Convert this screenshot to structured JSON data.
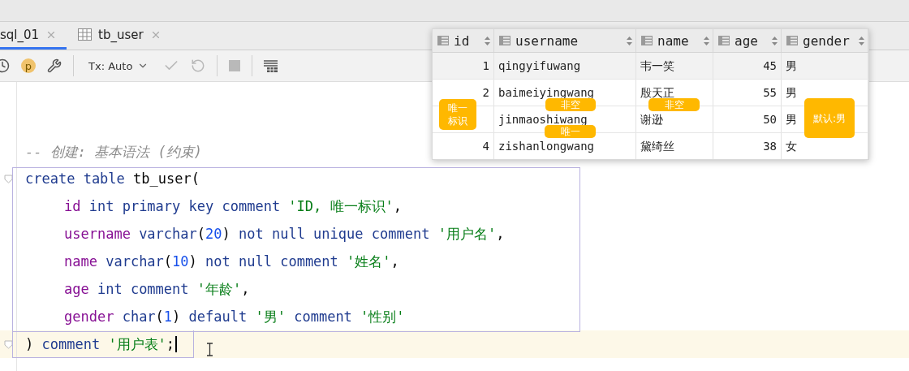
{
  "tabs": [
    {
      "label": "sql_01",
      "selected": true,
      "kind": "console"
    },
    {
      "label": "tb_user",
      "selected": false,
      "kind": "table"
    }
  ],
  "toolbar": {
    "profile": "p",
    "transaction": "Tx: Auto",
    "actions": [
      {
        "kind": "commit",
        "disabled": true
      },
      {
        "kind": "rollback",
        "disabled": true
      },
      {
        "kind": "stop",
        "disabled": true
      }
    ]
  },
  "editor": {
    "lines": [
      {
        "kind": "comment",
        "fold": false,
        "indent": false,
        "current": false,
        "tokens": [
          {
            "kind": "comment",
            "text": "-- 创建: 基本语法 (约束)"
          }
        ]
      },
      {
        "kind": "code",
        "fold": true,
        "indent": false,
        "current": false,
        "tokens": [
          {
            "kind": "keyword",
            "text": "create table "
          },
          {
            "kind": "plain",
            "text": "tb_user("
          }
        ]
      },
      {
        "kind": "code",
        "fold": false,
        "indent": true,
        "current": false,
        "tokens": [
          {
            "kind": "field",
            "text": "id"
          },
          {
            "kind": "keyword",
            "text": " int primary key comment "
          },
          {
            "kind": "string",
            "text": "'ID, 唯一标识'"
          },
          {
            "kind": "plain",
            "text": ","
          }
        ]
      },
      {
        "kind": "code",
        "fold": false,
        "indent": true,
        "current": false,
        "tokens": [
          {
            "kind": "field",
            "text": "username"
          },
          {
            "kind": "keyword",
            "text": " varchar"
          },
          {
            "kind": "plain",
            "text": "("
          },
          {
            "kind": "number",
            "text": "20"
          },
          {
            "kind": "plain",
            "text": ") "
          },
          {
            "kind": "keyword",
            "text": "not null unique comment "
          },
          {
            "kind": "string",
            "text": "'用户名'"
          },
          {
            "kind": "plain",
            "text": ","
          }
        ]
      },
      {
        "kind": "code",
        "fold": false,
        "indent": true,
        "current": false,
        "tokens": [
          {
            "kind": "field",
            "text": "name"
          },
          {
            "kind": "keyword",
            "text": " varchar"
          },
          {
            "kind": "plain",
            "text": "("
          },
          {
            "kind": "number",
            "text": "10"
          },
          {
            "kind": "plain",
            "text": ") "
          },
          {
            "kind": "keyword",
            "text": "not null comment "
          },
          {
            "kind": "string",
            "text": "'姓名'"
          },
          {
            "kind": "plain",
            "text": ","
          }
        ]
      },
      {
        "kind": "code",
        "fold": false,
        "indent": true,
        "current": false,
        "tokens": [
          {
            "kind": "field",
            "text": "age"
          },
          {
            "kind": "keyword",
            "text": " int comment "
          },
          {
            "kind": "string",
            "text": "'年龄'"
          },
          {
            "kind": "plain",
            "text": ","
          }
        ]
      },
      {
        "kind": "code",
        "fold": false,
        "indent": true,
        "current": false,
        "tokens": [
          {
            "kind": "field",
            "text": "gender"
          },
          {
            "kind": "keyword",
            "text": " char"
          },
          {
            "kind": "plain",
            "text": "("
          },
          {
            "kind": "number",
            "text": "1"
          },
          {
            "kind": "plain",
            "text": ") "
          },
          {
            "kind": "keyword",
            "text": "default "
          },
          {
            "kind": "string",
            "text": "'男'"
          },
          {
            "kind": "keyword",
            "text": " comment "
          },
          {
            "kind": "string",
            "text": "'性别'"
          }
        ]
      },
      {
        "kind": "code",
        "fold": true,
        "indent": false,
        "current": true,
        "tokens": [
          {
            "kind": "plain",
            "text": ") "
          },
          {
            "kind": "keyword",
            "text": "comment "
          },
          {
            "kind": "string",
            "text": "'用户表'"
          },
          {
            "kind": "plain",
            "text": ";"
          }
        ]
      }
    ]
  },
  "result": {
    "columns": [
      "id",
      "username",
      "name",
      "age",
      "gender"
    ],
    "rows": [
      {
        "id": "1",
        "username": "qingyifuwang",
        "name": "韦一笑",
        "age": "45",
        "gender": "男"
      },
      {
        "id": "2",
        "username": "baimeiyingwang",
        "name": "殷天正",
        "age": "55",
        "gender": "男"
      },
      {
        "username": "jinmaoshiwang",
        "name": "谢逊",
        "age": "50",
        "gender": "男"
      },
      {
        "id": "4",
        "username": "zishanlongwang",
        "name": "黛绮丝",
        "age": "38",
        "gender": "女"
      }
    ]
  },
  "callouts": [
    {
      "text": "唯一标识"
    },
    {
      "text": "非空"
    },
    {
      "text": "非空"
    },
    {
      "text": "唯一"
    },
    {
      "text": "默认:男"
    }
  ]
}
